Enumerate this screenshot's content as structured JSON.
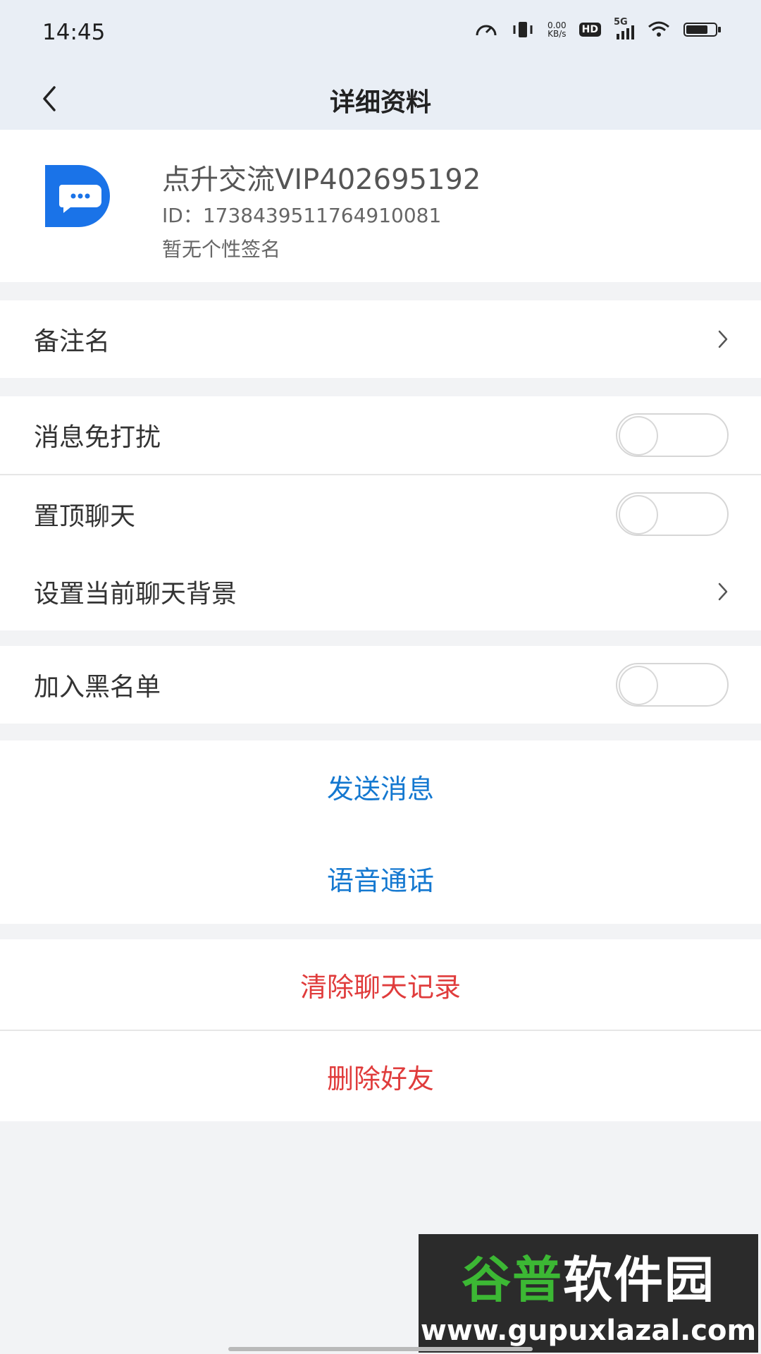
{
  "status_bar": {
    "time": "14:45",
    "net_speed_value": "0.00",
    "net_speed_unit": "KB/s",
    "hd": "HD",
    "signal_label": "5G"
  },
  "nav": {
    "title": "详细资料"
  },
  "profile": {
    "name": "点升交流VIP402695192",
    "id": "ID：1738439511764910081",
    "signature": "暂无个性签名"
  },
  "settings": {
    "remark_label": "备注名",
    "mute_label": "消息免打扰",
    "mute_on": false,
    "pin_label": "置顶聊天",
    "pin_on": false,
    "background_label": "设置当前聊天背景",
    "blacklist_label": "加入黑名单",
    "blacklist_on": false
  },
  "actions": {
    "send_message": "发送消息",
    "voice_call": "语音通话",
    "clear_history": "清除聊天记录",
    "delete_friend": "删除好友"
  },
  "watermark": {
    "title_green": "谷普",
    "title_white": "软件园",
    "url": "www.gupuxlazal.com"
  },
  "colors": {
    "accent_blue": "#1478D0",
    "danger_red": "#E03C3C",
    "avatar_blue": "#1A73E8"
  }
}
